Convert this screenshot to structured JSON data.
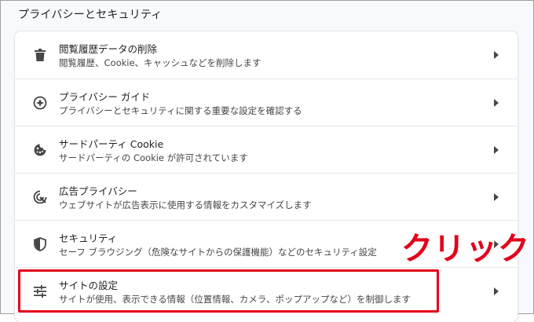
{
  "section": {
    "title": "プライバシーとセキュリティ"
  },
  "rows": [
    {
      "title": "閲覧履歴データの削除",
      "sub": "閲覧履歴、Cookie、キャッシュなどを削除します",
      "icon": "trash-icon"
    },
    {
      "title": "プライバシー ガイド",
      "sub": "プライバシーとセキュリティに関する重要な設定を確認する",
      "icon": "compass-icon"
    },
    {
      "title": "サードパーティ Cookie",
      "sub": "サードパーティの Cookie が許可されています",
      "icon": "cookie-icon"
    },
    {
      "title": "広告プライバシー",
      "sub": "ウェブサイトが広告表示に使用する情報をカスタマイズします",
      "icon": "ad-privacy-icon"
    },
    {
      "title": "セキュリティ",
      "sub": "セーフ ブラウジング（危険なサイトからの保護機能）などのセキュリティ設定",
      "icon": "shield-icon"
    },
    {
      "title": "サイトの設定",
      "sub": "サイトが使用、表示できる情報（位置情報、カメラ、ポップアップなど）を制御します",
      "icon": "tune-icon"
    }
  ],
  "annotation": {
    "label": "クリック",
    "color": "#e3001b"
  }
}
